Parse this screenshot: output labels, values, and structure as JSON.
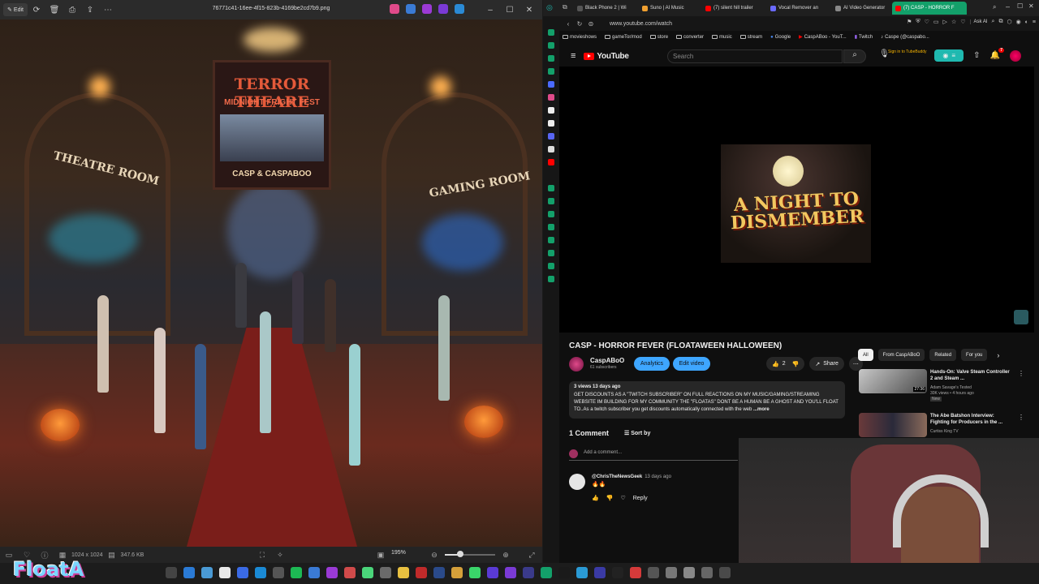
{
  "viewer": {
    "edit_label": "Edit",
    "filename": "76771c41-16ee-4f15-823b-4169be2cd7b9.png",
    "image_dims": "1024 x 1024",
    "file_size": "347.6 KB",
    "zoom": "195%",
    "zoom_level": 0.3,
    "poster": {
      "line1": "TERROR THEARE",
      "line2": "MIDNIGHT FRIGHT FEST",
      "line3": "CASP & CASPABOO"
    },
    "sign_left": "THEATRE ROOM",
    "sign_right": "GAMING ROOM"
  },
  "browser": {
    "tabs": [
      {
        "label": "Black Phone 2 | Wi",
        "color": "#555"
      },
      {
        "label": "Suno | AI Music",
        "color": "#f0a030"
      },
      {
        "label": "(7) silent hill trailer",
        "color": "#ff0000"
      },
      {
        "label": "Vocal Remover an",
        "color": "#6a6aff"
      },
      {
        "label": "AI Video Generator",
        "color": "#888"
      },
      {
        "label": "(7) CASP - HORROR F",
        "color": "#ff0000"
      }
    ],
    "url": "www.youtube.com/watch",
    "ask_ai": "Ask AI",
    "bookmarks": [
      "movieshows",
      "gameTor/mod",
      "store",
      "converter",
      "music",
      "stream",
      "Google",
      "CaspABoo - YouT...",
      "Twitch",
      "Caspe (@caspabo..."
    ]
  },
  "youtube": {
    "logo": "YouTube",
    "search_placeholder": "Search",
    "tubebuddy": "Sign in to TubeBuddy",
    "notif_count": "7",
    "video_frame_title": "A NIGHT TO DISMEMBER",
    "video_title": "CASP - HORROR FEVER (FLOATAWEEN HALLOWEEN)",
    "channel": "CaspABoO",
    "subscribers": "61 subscribers",
    "analytics": "Analytics",
    "edit_video": "Edit video",
    "likes": "2",
    "share": "Share",
    "meta": "3 views  13 days ago",
    "description": "GET DISCOUNTS AS A \"TWITCH SUBSCRIBER\" ON FULL REACTIONS ON MY MUSIC/GAMING/STREAMING WEBSITE IM BUILDING FOR MY COMMUNITY THE \"FLOATAS\" DONT BE A HUMAN BE A GHOST AND YOU'LL FLOAT TO..As a twitch subscriber you get discounts automatically connected with the web",
    "more": "...more",
    "comments_count": "1 Comment",
    "sort_by": "Sort by",
    "add_comment": "Add a comment...",
    "comment": {
      "author": "@ChrisTheNewsGeek",
      "time": "13 days ago",
      "text": "🔥🔥",
      "reply": "Reply"
    },
    "chips": [
      "All",
      "From CaspABoO",
      "Related",
      "For you"
    ],
    "recs": [
      {
        "title": "Hands-On: Valve Steam Controller 2 and Steam ...",
        "channel": "Adam Savage's Tested",
        "meta": "30K views • 4 hours ago",
        "badge": "New",
        "duration": "27:36"
      },
      {
        "title": "The Abe Batshon Interview: Fighting for Producers in the ...",
        "channel": "Curtiss King TV",
        "meta": "",
        "badge": "",
        "duration": ""
      }
    ]
  },
  "taskbar": {
    "logo": "FloatA"
  }
}
